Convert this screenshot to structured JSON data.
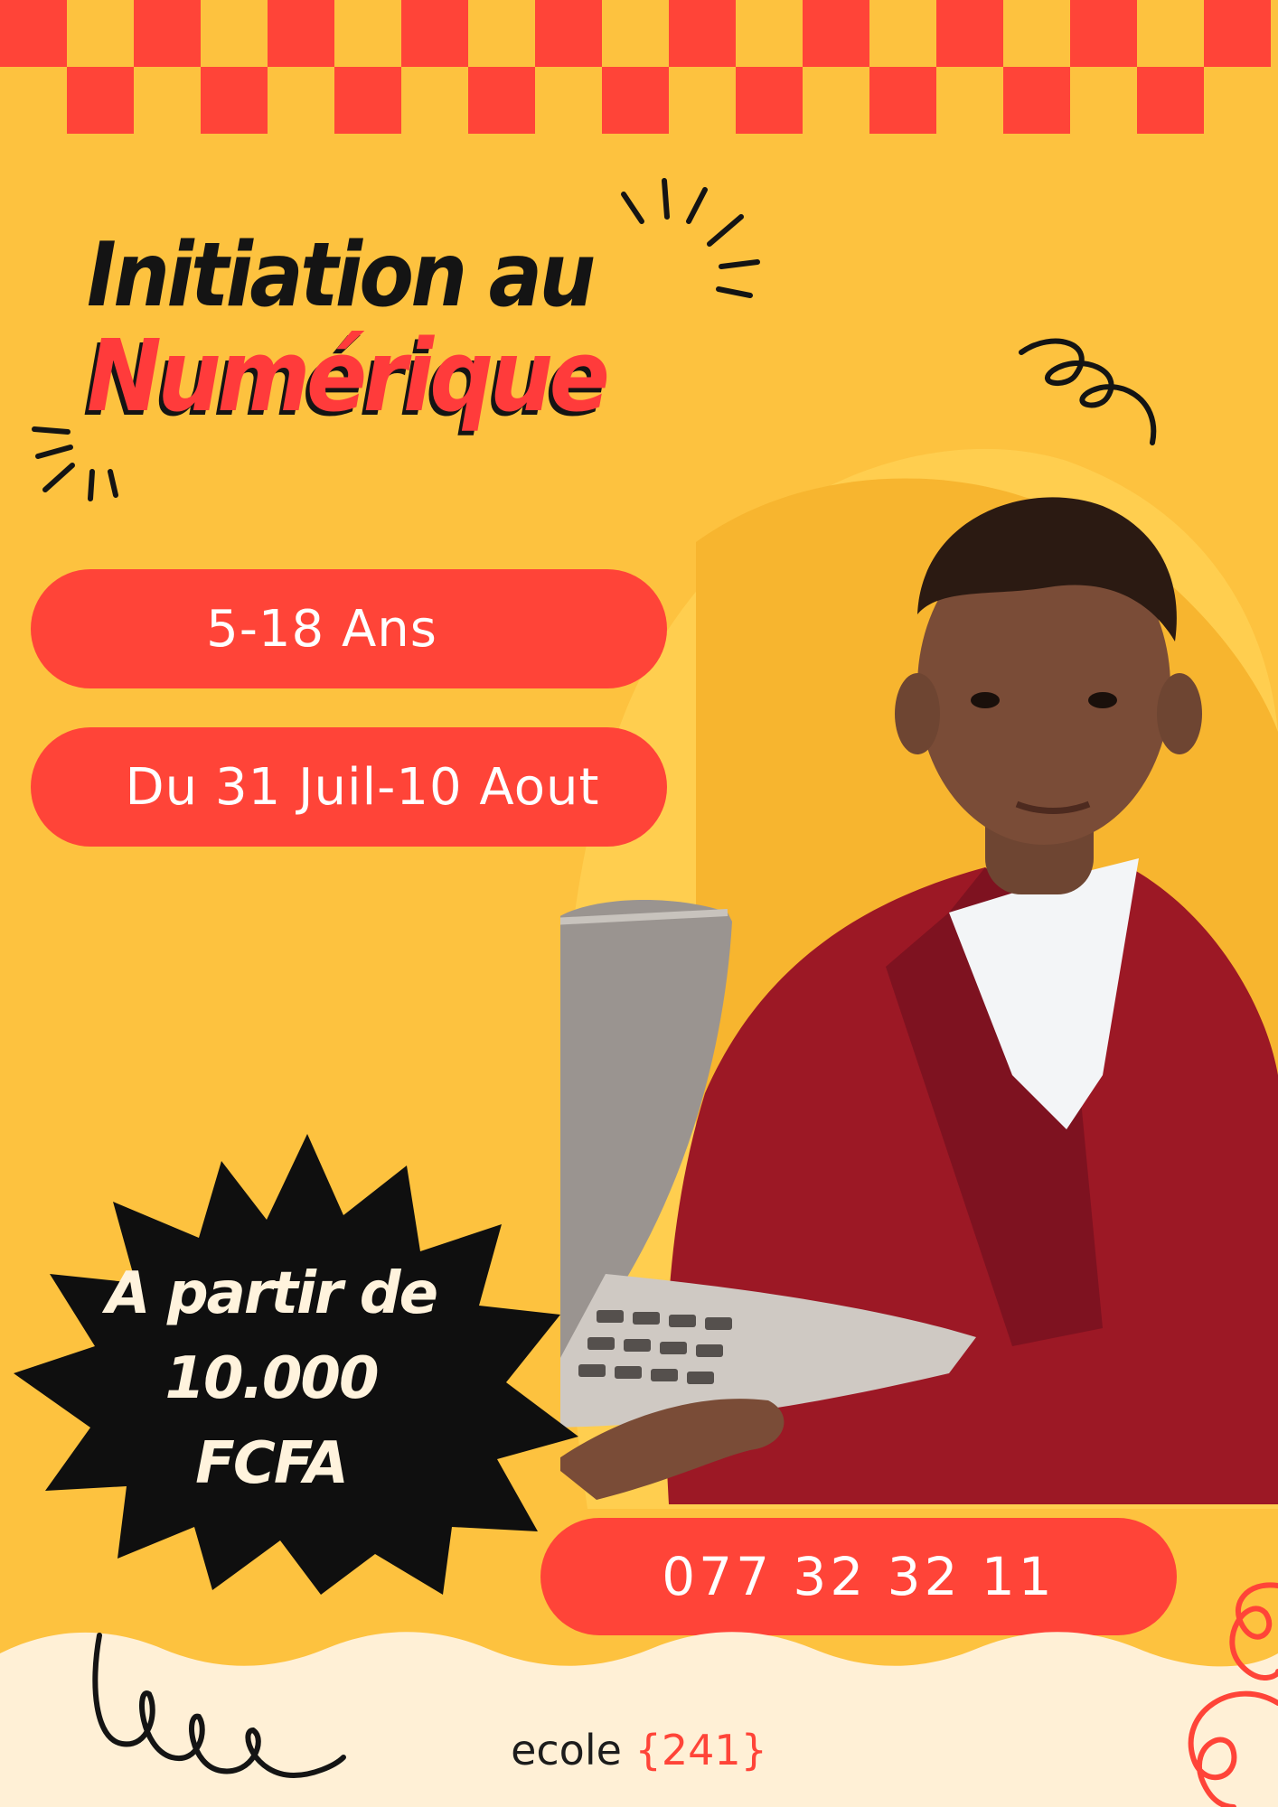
{
  "title": {
    "line1": "Initiation au",
    "line2": "Numérique"
  },
  "age_range": "5-18 Ans",
  "dates": "Du 31 Juil-10 Aout",
  "price": {
    "line1": "A  partir de",
    "line2": "10.000",
    "line3": "FCFA"
  },
  "phone": "077 32 32 11",
  "brand": {
    "name": "ecole",
    "code": "{241}"
  },
  "colors": {
    "background": "#fdc23f",
    "accent_red": "#ff4438",
    "dark": "#141414",
    "cream": "#fff0d6"
  },
  "image": "boy-holding-laptop-photo"
}
